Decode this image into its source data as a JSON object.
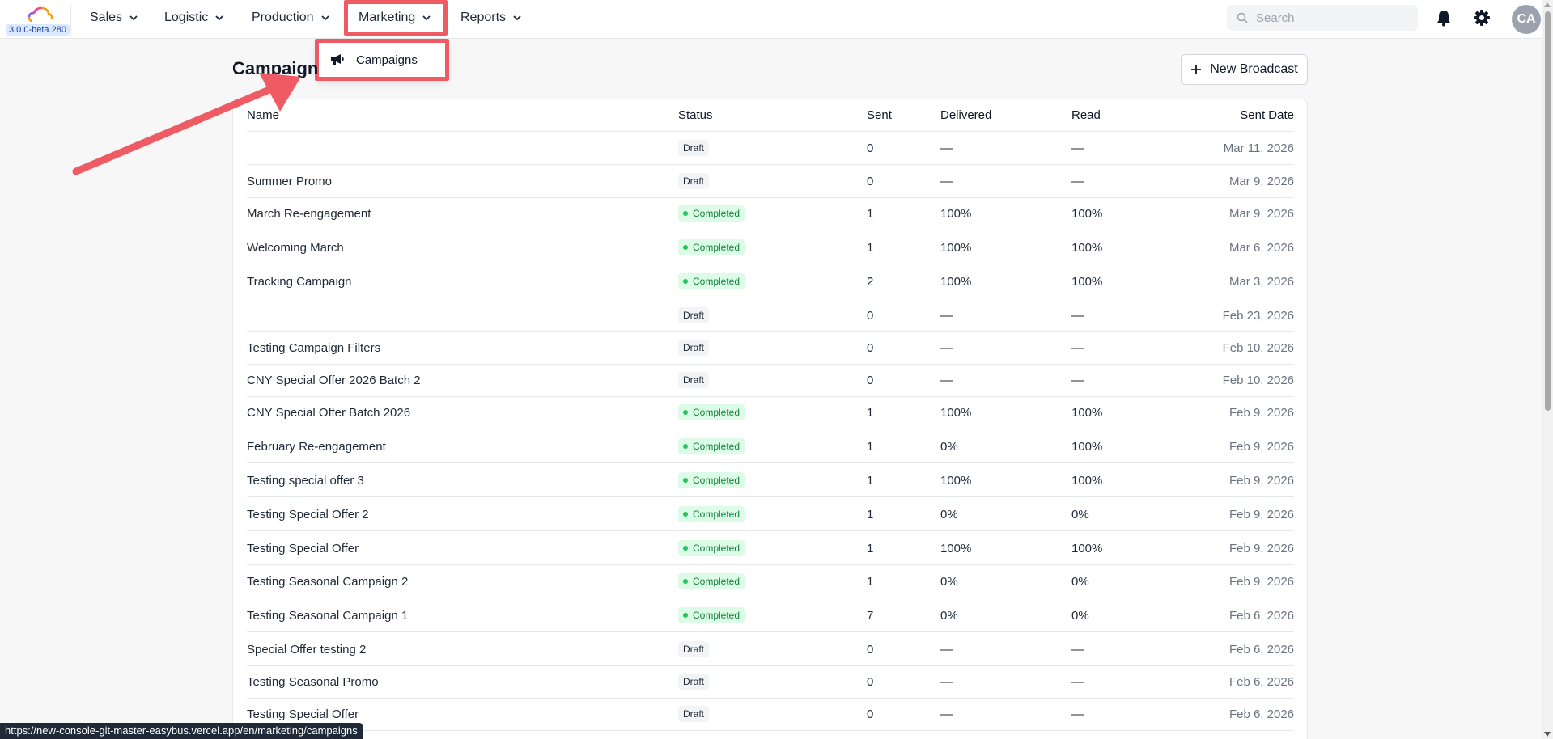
{
  "app": {
    "version": "3.0.0-beta.280"
  },
  "nav": {
    "items": [
      {
        "label": "Sales"
      },
      {
        "label": "Logistic"
      },
      {
        "label": "Production"
      },
      {
        "label": "Marketing"
      },
      {
        "label": "Reports"
      }
    ],
    "search_placeholder": "Search",
    "avatar_initials": "CA"
  },
  "dropdown": {
    "item_label": "Campaigns"
  },
  "page": {
    "title": "Campaign",
    "new_button": "New Broadcast"
  },
  "table": {
    "columns": [
      "Name",
      "Status",
      "Sent",
      "Delivered",
      "Read",
      "Sent Date"
    ],
    "rows": [
      {
        "name": "",
        "status": "Draft",
        "sent": "0",
        "delivered": "—",
        "read": "—",
        "date": "Mar 11, 2026"
      },
      {
        "name": "Summer Promo",
        "status": "Draft",
        "sent": "0",
        "delivered": "—",
        "read": "—",
        "date": "Mar 9, 2026"
      },
      {
        "name": "March Re-engagement",
        "status": "Completed",
        "sent": "1",
        "delivered": "100%",
        "read": "100%",
        "date": "Mar 9, 2026"
      },
      {
        "name": "Welcoming March",
        "status": "Completed",
        "sent": "1",
        "delivered": "100%",
        "read": "100%",
        "date": "Mar 6, 2026"
      },
      {
        "name": "Tracking Campaign",
        "status": "Completed",
        "sent": "2",
        "delivered": "100%",
        "read": "100%",
        "date": "Mar 3, 2026"
      },
      {
        "name": "",
        "status": "Draft",
        "sent": "0",
        "delivered": "—",
        "read": "—",
        "date": "Feb 23, 2026"
      },
      {
        "name": "Testing Campaign Filters",
        "status": "Draft",
        "sent": "0",
        "delivered": "—",
        "read": "—",
        "date": "Feb 10, 2026"
      },
      {
        "name": "CNY Special Offer 2026 Batch 2",
        "status": "Draft",
        "sent": "0",
        "delivered": "—",
        "read": "—",
        "date": "Feb 10, 2026"
      },
      {
        "name": "CNY Special Offer Batch 2026",
        "status": "Completed",
        "sent": "1",
        "delivered": "100%",
        "read": "100%",
        "date": "Feb 9, 2026"
      },
      {
        "name": "February Re-engagement",
        "status": "Completed",
        "sent": "1",
        "delivered": "0%",
        "read": "100%",
        "date": "Feb 9, 2026"
      },
      {
        "name": "Testing special offer 3",
        "status": "Completed",
        "sent": "1",
        "delivered": "100%",
        "read": "100%",
        "date": "Feb 9, 2026"
      },
      {
        "name": "Testing Special Offer 2",
        "status": "Completed",
        "sent": "1",
        "delivered": "0%",
        "read": "0%",
        "date": "Feb 9, 2026"
      },
      {
        "name": "Testing Special Offer",
        "status": "Completed",
        "sent": "1",
        "delivered": "100%",
        "read": "100%",
        "date": "Feb 9, 2026"
      },
      {
        "name": "Testing Seasonal Campaign 2",
        "status": "Completed",
        "sent": "1",
        "delivered": "0%",
        "read": "0%",
        "date": "Feb 9, 2026"
      },
      {
        "name": "Testing Seasonal Campaign 1",
        "status": "Completed",
        "sent": "7",
        "delivered": "0%",
        "read": "0%",
        "date": "Feb 6, 2026"
      },
      {
        "name": "Special Offer testing 2",
        "status": "Draft",
        "sent": "0",
        "delivered": "—",
        "read": "—",
        "date": "Feb 6, 2026"
      },
      {
        "name": "Testing Seasonal Promo",
        "status": "Draft",
        "sent": "0",
        "delivered": "—",
        "read": "—",
        "date": "Feb 6, 2026"
      },
      {
        "name": "Testing Special Offer",
        "status": "Draft",
        "sent": "0",
        "delivered": "—",
        "read": "—",
        "date": "Feb 6, 2026"
      }
    ]
  },
  "status_bar": {
    "url": "https://new-console-git-master-easybus.vercel.app/en/marketing/campaigns"
  },
  "colors": {
    "highlight": "#ef5b63",
    "completed_bg": "#dcfce7",
    "completed_text": "#15803d",
    "draft_bg": "#f3f4f6"
  }
}
